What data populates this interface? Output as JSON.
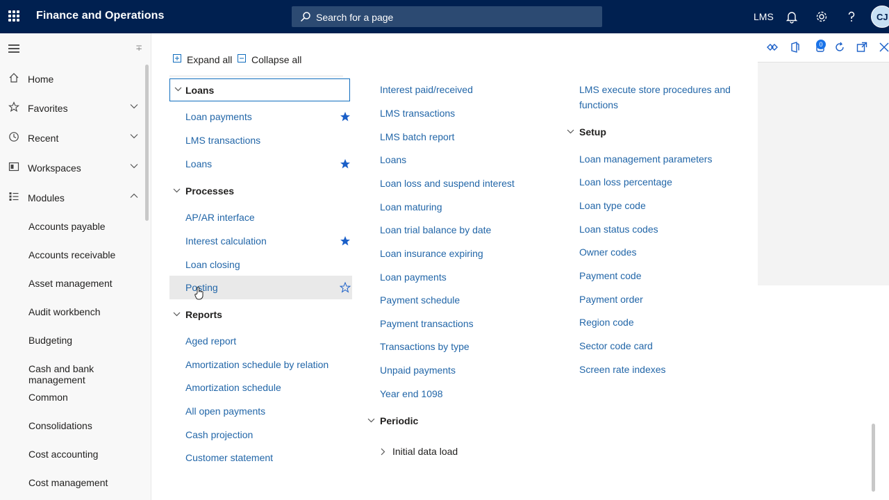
{
  "app": {
    "title": "Finance and Operations"
  },
  "search": {
    "placeholder": "Search for a page"
  },
  "topbar": {
    "company": "LMS",
    "user_initials": "CJ"
  },
  "nav": {
    "items": [
      {
        "label": "Home",
        "icon": "home-icon"
      },
      {
        "label": "Favorites",
        "icon": "star-icon"
      },
      {
        "label": "Recent",
        "icon": "clock-icon"
      },
      {
        "label": "Workspaces",
        "icon": "workspace-icon"
      },
      {
        "label": "Modules",
        "icon": "list-icon"
      }
    ],
    "modules": [
      "Accounts payable",
      "Accounts receivable",
      "Asset management",
      "Audit workbench",
      "Budgeting",
      "Cash and bank management",
      "Common",
      "Consolidations",
      "Cost accounting",
      "Cost management"
    ]
  },
  "toolbar": {
    "expand_all": "Expand all",
    "collapse_all": "Collapse all"
  },
  "col1": {
    "loans": {
      "title": "Loans",
      "items": [
        "Loan payments",
        "LMS transactions",
        "Loans"
      ]
    },
    "processes": {
      "title": "Processes",
      "items": [
        "AP/AR interface",
        "Interest calculation",
        "Loan closing",
        "Posting"
      ]
    },
    "reports": {
      "title": "Reports",
      "items": [
        "Aged report",
        "Amortization schedule by relation",
        "Amortization schedule",
        "All open payments",
        "Cash projection",
        "Customer statement"
      ]
    }
  },
  "col2": {
    "items": [
      "Interest paid/received",
      "LMS transactions",
      "LMS batch report",
      "Loans",
      "Loan loss and suspend interest",
      "Loan maturing",
      "Loan trial balance by date",
      "Loan insurance expiring",
      "Loan payments",
      "Payment schedule",
      "Payment transactions",
      "Transactions by type",
      "Unpaid payments",
      "Year end 1098"
    ],
    "periodic": {
      "title": "Periodic",
      "items": [
        "Initial data load"
      ]
    }
  },
  "col3": {
    "items": [
      "LMS execute store procedures and",
      "functions"
    ],
    "setup": {
      "title": "Setup",
      "items": [
        "Loan management parameters",
        "Loan loss percentage",
        "Loan type code",
        "Loan status codes",
        "Owner codes",
        "Payment code",
        "Payment order",
        "Region code",
        "Sector code card",
        "Screen rate indexes"
      ]
    }
  },
  "rightstrip": {
    "badge_count": "0"
  },
  "colors": {
    "topbar": "#002050",
    "link": "#2266a8",
    "accent": "#0f6cbd",
    "star": "#1a5fc8"
  }
}
